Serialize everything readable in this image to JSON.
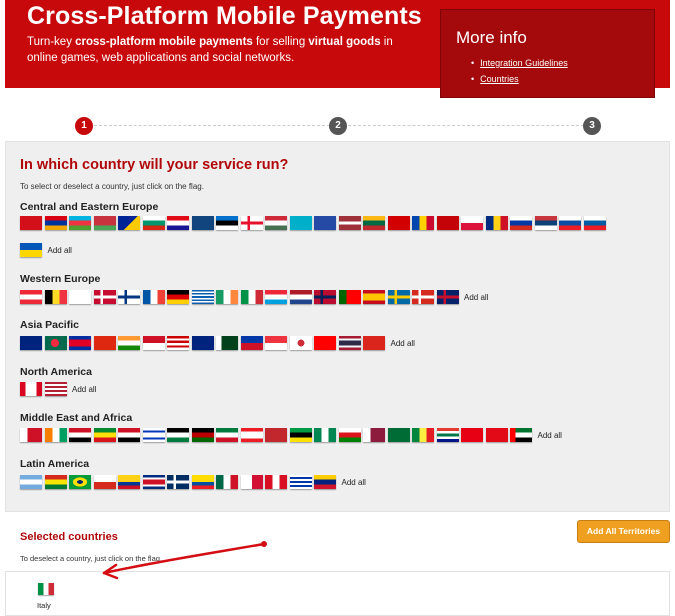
{
  "header": {
    "title": "Cross-Platform Mobile Payments",
    "tagline_parts": [
      {
        "text": "Turn-key ",
        "bold": false
      },
      {
        "text": "cross-platform mobile payments",
        "bold": true
      },
      {
        "text": " for selling ",
        "bold": false
      },
      {
        "text": "virtual goods",
        "bold": true
      },
      {
        "text": " in online games, web applications and social networks.",
        "bold": false
      }
    ],
    "colors": {
      "background": "#c8090b",
      "more_info_background": "#a40a0c"
    }
  },
  "more_info": {
    "title": "More info",
    "links": [
      "Integration Guidelines",
      "Countries"
    ]
  },
  "steps": [
    {
      "label": "1",
      "active": true
    },
    {
      "label": "2",
      "active": false
    },
    {
      "label": "3",
      "active": false
    }
  ],
  "selection": {
    "question": "In which country will your service run?",
    "hint": "To select or deselect a country, just click on the flag.",
    "regions": [
      {
        "name": "Central and Eastern Europe",
        "flags": [
          "albania",
          "armenia",
          "azerbaijan",
          "belarus",
          "bosnia-herzegovina",
          "bulgaria",
          "croatia",
          "czech-republic",
          "estonia",
          "georgia",
          "hungary",
          "kazakhstan",
          "kosovo",
          "latvia",
          "lithuania",
          "macedonia",
          "moldova",
          "montenegro",
          "poland",
          "romania",
          "russia",
          "serbia",
          "slovakia",
          "slovenia",
          "ukraine"
        ],
        "add_all": "Add all"
      },
      {
        "name": "Western Europe",
        "flags": [
          "austria",
          "belgium",
          "cyprus",
          "denmark",
          "finland",
          "france",
          "germany",
          "greece",
          "ireland",
          "italy",
          "luxembourg",
          "netherlands",
          "norway",
          "portugal",
          "spain",
          "sweden",
          "switzerland",
          "united-kingdom"
        ],
        "add_all": "Add all"
      },
      {
        "name": "Asia Pacific",
        "flags": [
          "australia",
          "bangladesh",
          "cambodia",
          "hong-kong",
          "india",
          "indonesia",
          "malaysia",
          "new-zealand",
          "pakistan",
          "philippines",
          "singapore",
          "south-korea",
          "taiwan",
          "thailand",
          "vietnam"
        ],
        "add_all": "Add all"
      },
      {
        "name": "North America",
        "flags": [
          "canada",
          "united-states"
        ],
        "add_all": "Add all"
      },
      {
        "name": "Middle East and Africa",
        "flags": [
          "bahrain",
          "cote-divoire",
          "egypt",
          "ethiopia",
          "iraq",
          "israel",
          "jordan",
          "kenya",
          "kuwait",
          "lebanon",
          "morocco",
          "mozambique",
          "nigeria",
          "oman",
          "qatar",
          "saudi-arabia",
          "senegal",
          "south-africa",
          "tunisia",
          "turkey",
          "united-arab-emirates"
        ],
        "add_all": "Add all"
      },
      {
        "name": "Latin America",
        "flags": [
          "argentina",
          "bolivia",
          "brazil",
          "chile",
          "colombia",
          "costa-rica",
          "dominican-republic",
          "ecuador",
          "mexico",
          "panama",
          "peru",
          "uruguay",
          "venezuela"
        ],
        "add_all": "Add all"
      }
    ]
  },
  "selected": {
    "title": "Selected countries",
    "hint": "To deselect a country, just click on the flag.",
    "add_all_button": "Add All Territories",
    "countries": [
      {
        "flag": "italy",
        "label": "Italy"
      }
    ]
  }
}
